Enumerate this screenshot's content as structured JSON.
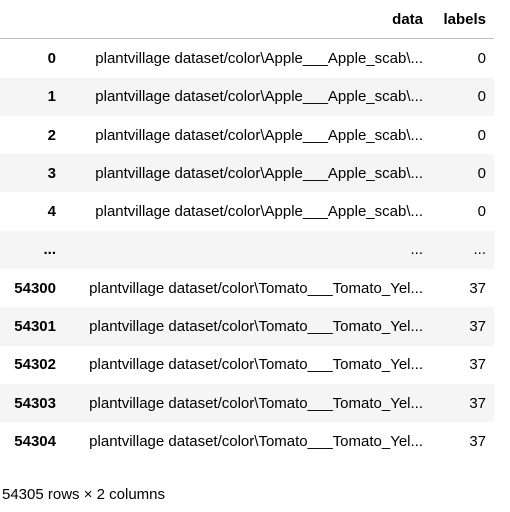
{
  "table": {
    "columns": [
      "",
      "data",
      "labels"
    ],
    "rows": [
      {
        "index": "0",
        "data": "plantvillage dataset/color\\Apple___Apple_scab\\...",
        "labels": "0"
      },
      {
        "index": "1",
        "data": "plantvillage dataset/color\\Apple___Apple_scab\\...",
        "labels": "0"
      },
      {
        "index": "2",
        "data": "plantvillage dataset/color\\Apple___Apple_scab\\...",
        "labels": "0"
      },
      {
        "index": "3",
        "data": "plantvillage dataset/color\\Apple___Apple_scab\\...",
        "labels": "0"
      },
      {
        "index": "4",
        "data": "plantvillage dataset/color\\Apple___Apple_scab\\...",
        "labels": "0"
      },
      {
        "index": "...",
        "data": "...",
        "labels": "..."
      },
      {
        "index": "54300",
        "data": "plantvillage dataset/color\\Tomato___Tomato_Yel...",
        "labels": "37"
      },
      {
        "index": "54301",
        "data": "plantvillage dataset/color\\Tomato___Tomato_Yel...",
        "labels": "37"
      },
      {
        "index": "54302",
        "data": "plantvillage dataset/color\\Tomato___Tomato_Yel...",
        "labels": "37"
      },
      {
        "index": "54303",
        "data": "plantvillage dataset/color\\Tomato___Tomato_Yel...",
        "labels": "37"
      },
      {
        "index": "54304",
        "data": "plantvillage dataset/color\\Tomato___Tomato_Yel...",
        "labels": "37"
      }
    ]
  },
  "footer": "54305 rows × 2 columns"
}
